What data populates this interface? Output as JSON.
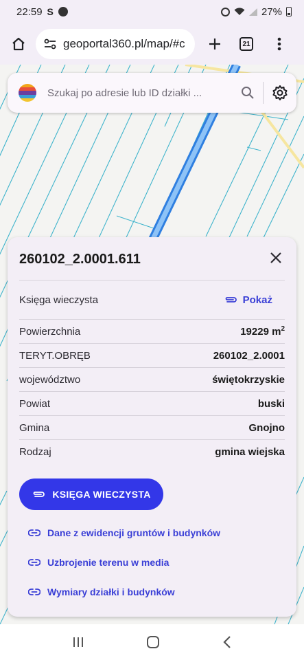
{
  "status_bar": {
    "time": "22:59",
    "app_glyph": "S",
    "battery": "27%"
  },
  "browser": {
    "url": "geoportal360.pl/map/#c",
    "tab_count": "21"
  },
  "search": {
    "placeholder": "Szukaj po adresie lub ID działki ..."
  },
  "panel": {
    "title": "260102_2.0001.611",
    "kw_label": "Księga wieczysta",
    "kw_action": "Pokaż",
    "rows": [
      {
        "label": "Powierzchnia",
        "value": "19229 m",
        "sup": "2"
      },
      {
        "label": "TERYT.OBRĘB",
        "value": "260102_2.0001"
      },
      {
        "label": "województwo",
        "value": "świętokrzyskie"
      },
      {
        "label": "Powiat",
        "value": "buski"
      },
      {
        "label": "Gmina",
        "value": "Gnojno"
      },
      {
        "label": "Rodzaj",
        "value": "gmina wiejska"
      }
    ],
    "primary_button": "KSIĘGA WIECZYSTA",
    "links": [
      "Dane z ewidencji gruntów i budynków",
      "Uzbrojenie terenu w media",
      "Wymiary działki i budynków"
    ]
  },
  "colors": {
    "accent": "#3337e8",
    "link": "#3a3fd6",
    "parcel_lines": "#3fb4cc",
    "road": "#5aa0f0",
    "panel_bg": "#f3eef6"
  },
  "icons": [
    "home-icon",
    "site-settings-icon",
    "plus-icon",
    "tabs-icon",
    "more-vert-icon",
    "search-icon",
    "gear-icon",
    "close-icon",
    "attachment-icon",
    "link-icon",
    "recents-icon",
    "home-nav-icon",
    "back-icon"
  ]
}
